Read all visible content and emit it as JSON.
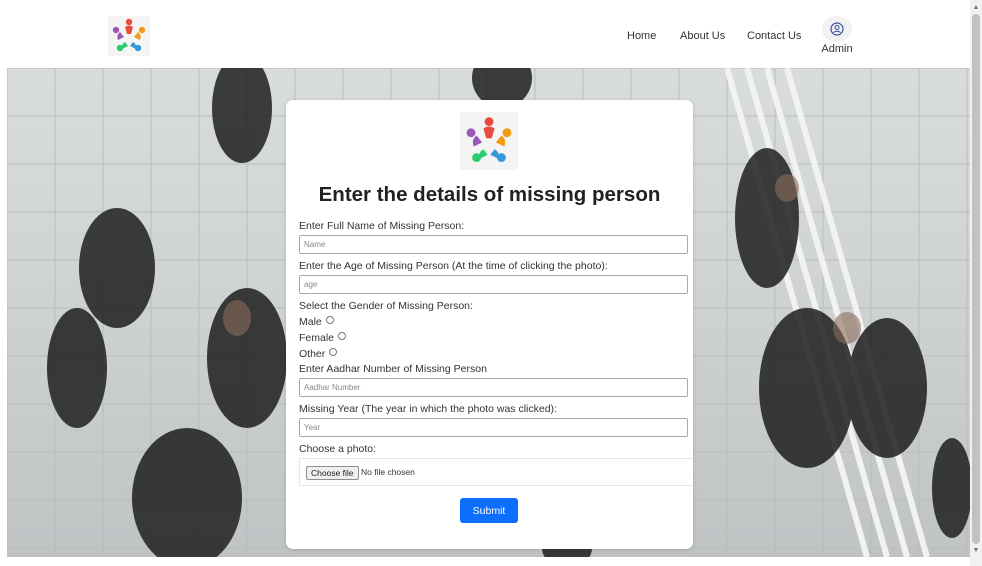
{
  "nav": {
    "home": "Home",
    "about": "About Us",
    "contact": "Contact Us",
    "admin": "Admin"
  },
  "form": {
    "title": "Enter the details of missing person",
    "name_label": "Enter Full Name of Missing Person:",
    "name_placeholder": "Name",
    "age_label": "Enter the Age of Missing Person (At the time of clicking the photo):",
    "age_placeholder": "age",
    "gender_label": "Select the Gender of Missing Person:",
    "gender_options": [
      "Male",
      "Female",
      "Other"
    ],
    "aadhar_label": "Enter Aadhar Number of Missing Person",
    "aadhar_placeholder": "Aadhar Number",
    "year_label": "Missing Year (The year in which the photo was clicked):",
    "year_placeholder": "Year",
    "photo_label": "Choose a photo:",
    "file_button": "Choose file",
    "file_status": "No file chosen",
    "submit": "Submit"
  },
  "colors": {
    "primary": "#0d6efd",
    "logo": [
      "#e74c3c",
      "#f39c12",
      "#2ecc71",
      "#3498db",
      "#9b59b6"
    ]
  }
}
